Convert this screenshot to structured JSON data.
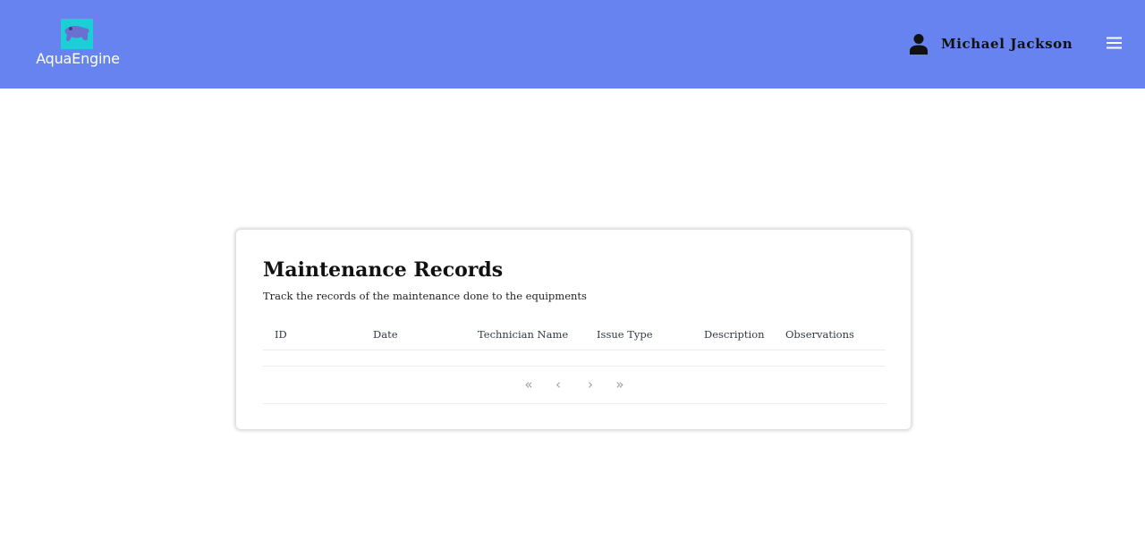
{
  "header": {
    "brand": "AquaEngine",
    "user_name": "Michael Jackson",
    "bg_color": "#6683f0",
    "logo_color": "#1ad0d6"
  },
  "page": {
    "title": "Maintenance Records",
    "subtitle": "Track the records of the maintenance done to the equipments"
  },
  "table": {
    "columns": [
      "ID",
      "Date",
      "Technician Name",
      "Issue Type",
      "Description",
      "Observations"
    ],
    "rows": []
  },
  "pagination": {
    "first": "«",
    "prev": "‹",
    "next": "›",
    "last": "»"
  }
}
